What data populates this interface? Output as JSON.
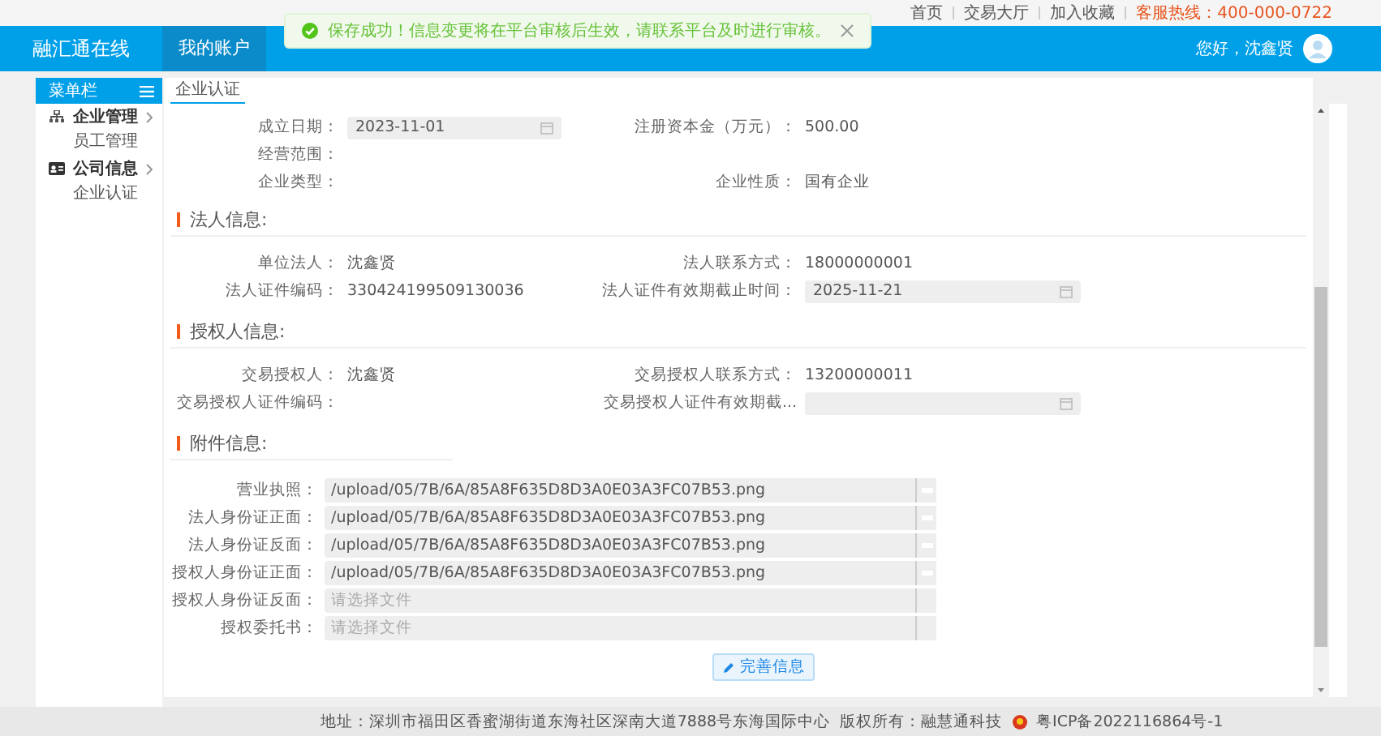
{
  "top_links": [
    {
      "label": "首页"
    },
    {
      "label": "交易大厅"
    },
    {
      "label": "加入收藏"
    }
  ],
  "hotline": "客服热线：400-000-0722",
  "header": {
    "logo": "融汇通在线",
    "nav": [
      {
        "label": "我的账户",
        "selected": true
      }
    ],
    "greeting": "您好，沈鑫贤"
  },
  "toast": {
    "kind": "success",
    "message": "保存成功！信息变更将在平台审核后生效，请联系平台及时进行审核。"
  },
  "sidebar": {
    "title": "菜单栏",
    "items": [
      {
        "label": "企业管理",
        "children": [
          {
            "label": "员工管理"
          }
        ]
      },
      {
        "label": "公司信息",
        "children": [
          {
            "label": "企业认证"
          }
        ]
      }
    ]
  },
  "tabs": [
    {
      "label": "企业认证",
      "selected": true
    }
  ],
  "company": {
    "rows": [
      [
        {
          "label": "成立日期：",
          "kind": "date",
          "value": "2023-11-01"
        },
        {
          "label": "注册资本金（万元）：",
          "kind": "text",
          "value": "500.00"
        }
      ],
      [
        {
          "label": "经营范围：",
          "kind": "text"
        }
      ],
      [
        {
          "label": "企业类型：",
          "kind": "text"
        },
        {
          "label": "企业性质：",
          "kind": "text",
          "value": "国有企业"
        }
      ]
    ]
  },
  "sections": [
    {
      "title": "法人信息:",
      "rows": [
        [
          {
            "label": "单位法人：",
            "kind": "text",
            "value": "沈鑫贤"
          },
          {
            "label": "法人联系方式：",
            "kind": "text",
            "value": "18000000001"
          }
        ],
        [
          {
            "label": "法人证件编码：",
            "kind": "text",
            "value": "330424199509130036"
          },
          {
            "label": "法人证件有效期截止时间：",
            "kind": "date",
            "value": "2025-11-21"
          }
        ]
      ]
    },
    {
      "title": "授权人信息:",
      "rows": [
        [
          {
            "label": "交易授权人：",
            "kind": "text",
            "value": "沈鑫贤"
          },
          {
            "label": "交易授权人联系方式：",
            "kind": "text",
            "value": "13200000011"
          }
        ],
        [
          {
            "label": "交易授权人证件编码：",
            "kind": "text"
          },
          {
            "label": "交易授权人证件有效期截...",
            "kind": "date"
          }
        ]
      ]
    }
  ],
  "attachments": {
    "title": "附件信息:",
    "files": [
      {
        "label": "营业执照：",
        "value": "/upload/05/7B/6A/85A8F635D8D3A0E03A3FC07B53.png"
      },
      {
        "label": "法人身份证正面：",
        "value": "/upload/05/7B/6A/85A8F635D8D3A0E03A3FC07B53.png"
      },
      {
        "label": "法人身份证反面：",
        "value": "/upload/05/7B/6A/85A8F635D8D3A0E03A3FC07B53.png"
      },
      {
        "label": "授权人身份证正面：",
        "value": "/upload/05/7B/6A/85A8F635D8D3A0E03A3FC07B53.png"
      },
      {
        "label": "授权人身份证反面：",
        "placeholder": "请选择文件"
      },
      {
        "label": "授权委托书：",
        "placeholder": "请选择文件"
      }
    ],
    "button": "完善信息"
  },
  "footer": {
    "address": "地址：深圳市福田区香蜜湖街道东海社区深南大道7888号东海国际中心",
    "copyright": "版权所有：融慧通科技",
    "icp": "粤ICP备2022116864号-1"
  }
}
